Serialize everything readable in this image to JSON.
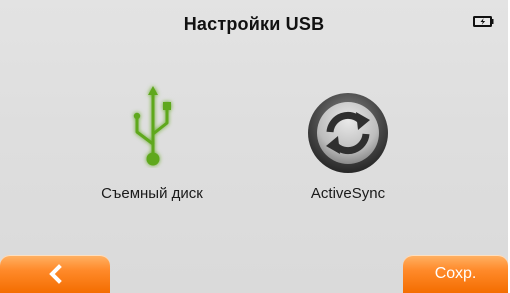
{
  "header": {
    "title": "Настройки USB"
  },
  "status": {
    "battery_icon": "battery-charging-icon"
  },
  "options": [
    {
      "label": "Съемный диск",
      "icon": "usb-icon",
      "icon_color": "#5fa81c"
    },
    {
      "label": "ActiveSync",
      "icon": "activesync-icon",
      "icon_color": "#4a4a4a"
    }
  ],
  "footer": {
    "back_icon": "chevron-left-icon",
    "save_label": "Сохр."
  },
  "colors": {
    "button_orange": "#ff8a2a",
    "background": "#dedede"
  }
}
